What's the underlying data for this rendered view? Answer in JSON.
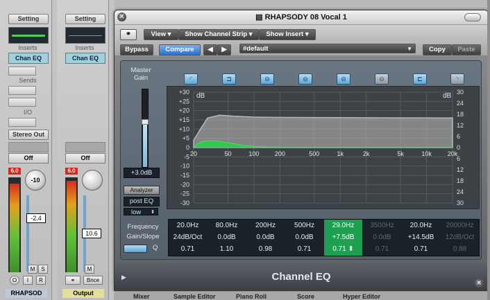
{
  "strips": [
    {
      "setting": "Setting",
      "inserts": "Inserts",
      "insert_1": "Chan EQ",
      "sends": "Sends",
      "io": "I/O",
      "output": "Stereo Out",
      "automation": "Off",
      "peak": "6.0",
      "pan": "-10",
      "volume": "-2.4",
      "mute": "M",
      "solo": "S",
      "btn_o": "O",
      "btn_i": "I",
      "btn_r": "R",
      "name": "RHAPSOD"
    },
    {
      "setting": "Setting",
      "inserts": "Inserts",
      "insert_1": "Chan EQ",
      "automation": "Off",
      "peak": "6.0",
      "volume": "10.6",
      "mute": "M",
      "bnce": "Bnce",
      "name": "Output"
    }
  ],
  "window": {
    "title": "RHAPSODY 08 Vocal 1",
    "close_glyph": "✕"
  },
  "toolbar": {
    "view": "View",
    "show_channel_strip": "Show Channel Strip",
    "show_insert": "Show Insert",
    "bypass": "Bypass",
    "compare": "Compare",
    "prev": "◀",
    "next": "▶",
    "preset": "#default",
    "copy": "Copy",
    "paste": "Paste",
    "arrow_down": "▼"
  },
  "master": {
    "label_line1": "Master",
    "label_line2": "Gain",
    "value": "+3.0dB",
    "analyzer": "Analyzer",
    "analyzer_mode": "post EQ",
    "resolution": "low",
    "stepper": "⬍"
  },
  "band_icons": [
    "low-cut",
    "low-shelf",
    "parametric",
    "parametric",
    "parametric",
    "parametric",
    "high-shelf",
    "high-cut"
  ],
  "graph": {
    "db_label_left": "dB",
    "db_label_right": "dB",
    "left_scale": [
      "+30",
      "+25",
      "+20",
      "+15",
      "+10",
      "+5",
      "0",
      "-5",
      "-10",
      "-15",
      "-20",
      "-25",
      "-30"
    ],
    "right_scale": [
      "30",
      "24",
      "18",
      "12",
      "6",
      "0",
      "6",
      "12",
      "18",
      "24",
      "30"
    ],
    "freq_labels": [
      "20",
      "50",
      "100",
      "200",
      "500",
      "1k",
      "2k",
      "5k",
      "10k",
      "20k"
    ]
  },
  "params": {
    "frequency_label": "Frequency",
    "gainslope_label": "Gain/Slope",
    "q_label": "Q",
    "columns": [
      {
        "freq": "20.0Hz",
        "gain": "24dB/Oct",
        "q": "0.71",
        "state": "on"
      },
      {
        "freq": "80.0Hz",
        "gain": "0.0dB",
        "q": "1.10",
        "state": "on"
      },
      {
        "freq": "200Hz",
        "gain": "0.0dB",
        "q": "0.98",
        "state": "on"
      },
      {
        "freq": "500Hz",
        "gain": "0.0dB",
        "q": "0.71",
        "state": "on"
      },
      {
        "freq": "29.0Hz",
        "gain": "+7.5dB",
        "q": "0.71",
        "state": "selected"
      },
      {
        "freq": "3500Hz",
        "gain": "0.0dB",
        "q": "0.71",
        "state": "off"
      },
      {
        "freq": "20.0Hz",
        "gain": "+14.5dB",
        "q": "0.71",
        "state": "on"
      },
      {
        "freq": "20000Hz",
        "gain": "12dB/Oct",
        "q": "0.88",
        "state": "off"
      }
    ],
    "stepper": "⬍"
  },
  "footer": {
    "plugin_name": "Channel EQ",
    "disclosure": "▶",
    "resize_glyph": "✕"
  },
  "bottom_tabs": [
    "Mixer",
    "Sample Editor",
    "Piano Roll",
    "Score",
    "Hyper Editor"
  ],
  "colors": {
    "eq_curve": "#b9b9b9",
    "analyzer": "#2ec84a",
    "selected": "#1fa050",
    "compare": "#3d7bd1"
  }
}
